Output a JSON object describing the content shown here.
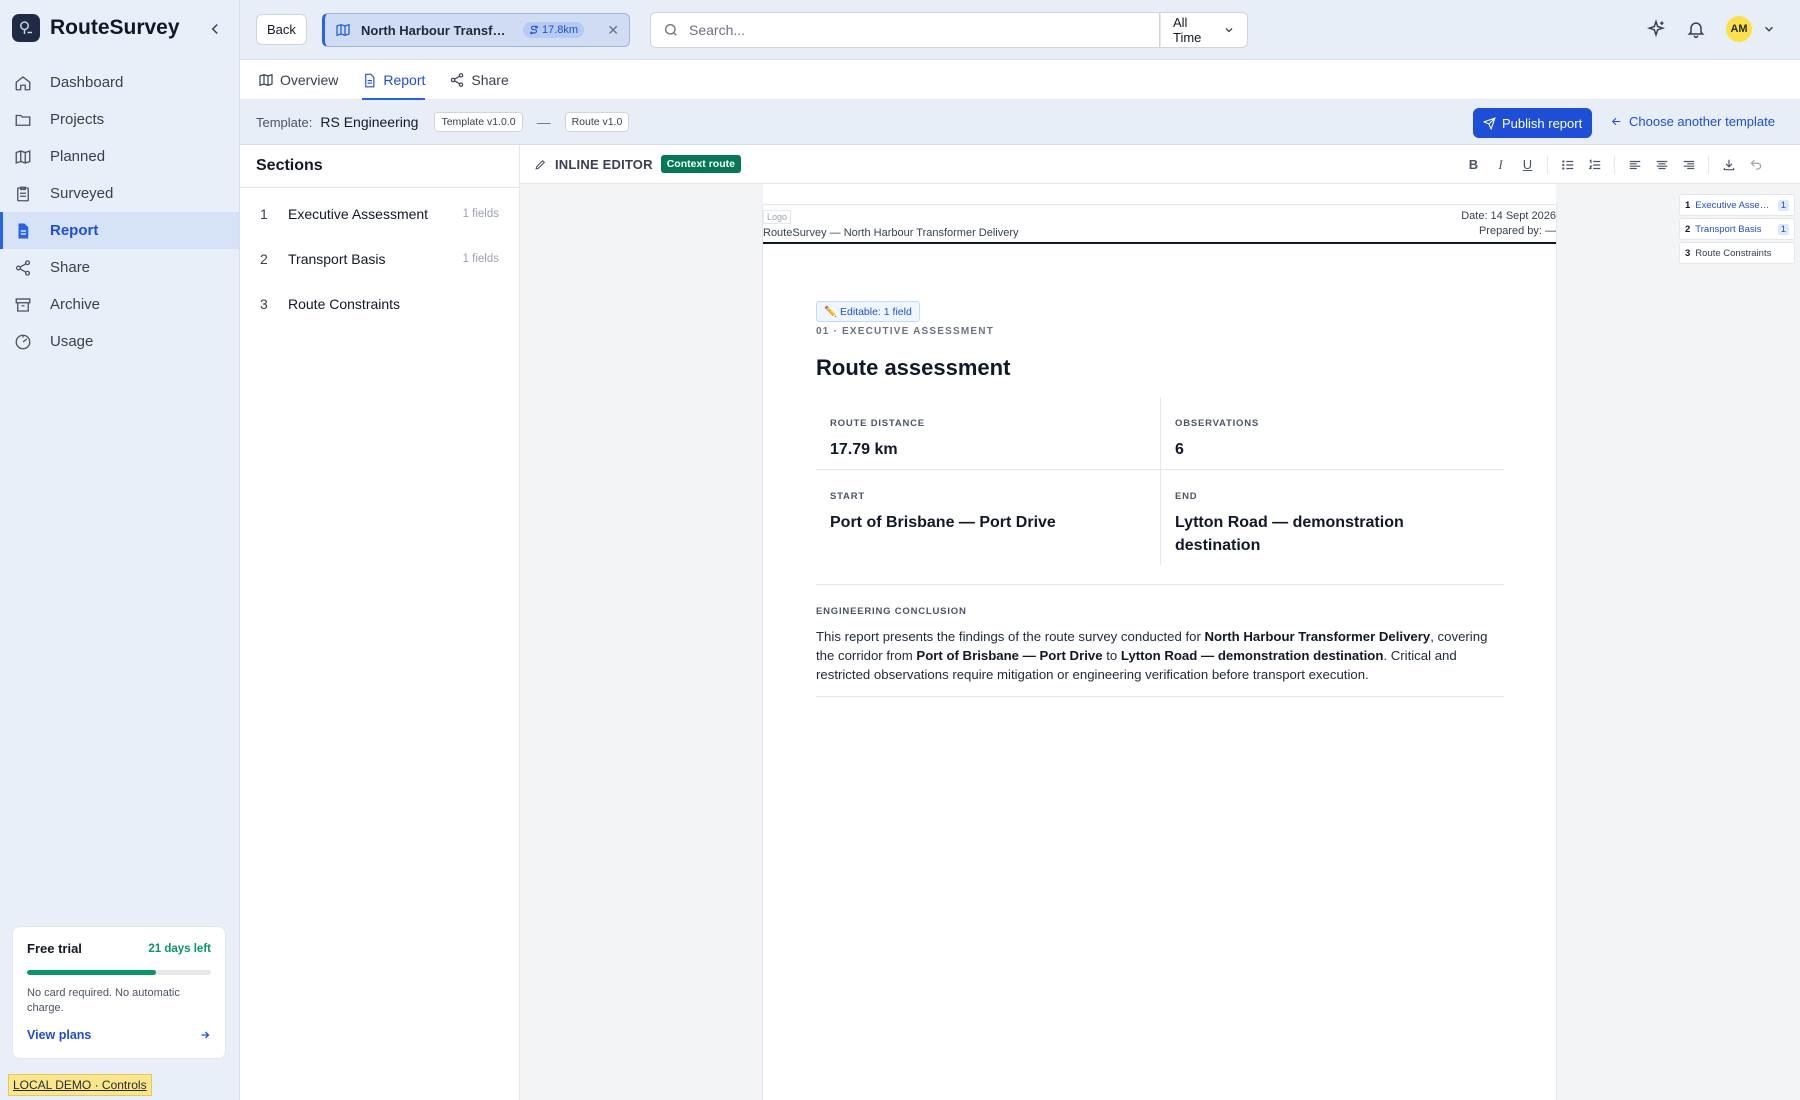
{
  "app": {
    "name": "RouteSurvey"
  },
  "nav": [
    {
      "label": "Dashboard",
      "icon": "home-icon"
    },
    {
      "label": "Projects",
      "icon": "folder-icon"
    },
    {
      "label": "Planned",
      "icon": "map-icon"
    },
    {
      "label": "Surveyed",
      "icon": "clipboard-icon"
    },
    {
      "label": "Report",
      "icon": "document-icon",
      "active": true
    },
    {
      "label": "Share",
      "icon": "share-icon"
    },
    {
      "label": "Archive",
      "icon": "archive-icon"
    },
    {
      "label": "Usage",
      "icon": "gauge-icon"
    }
  ],
  "trial": {
    "title": "Free trial",
    "days_left": "21 days left",
    "progress": 0.7,
    "note": "No card required. No automatic charge.",
    "link": "View plans"
  },
  "demo_badge": "LOCAL DEMO · Controls",
  "topbar": {
    "back": "Back",
    "route_title": "North Harbour Transformer Delivery",
    "route_km": "17.8km",
    "search_placeholder": "Search...",
    "range": "All Time",
    "avatar": "AM"
  },
  "tabs": [
    {
      "label": "Overview",
      "icon": "map-icon"
    },
    {
      "label": "Report",
      "icon": "document-icon",
      "active": true
    },
    {
      "label": "Share",
      "icon": "share-icon"
    }
  ],
  "template_bar": {
    "label": "Template:",
    "name": "RS Engineering",
    "template_version": "Template v1.0.0",
    "dash": "—",
    "route_version": "Route v1.0",
    "publish": "Publish report",
    "choose": "Choose another template"
  },
  "sections": {
    "title": "Sections",
    "items": [
      {
        "num": "1",
        "name": "Executive Assessment",
        "count": "1 fields"
      },
      {
        "num": "2",
        "name": "Transport Basis",
        "count": "1 fields"
      },
      {
        "num": "3",
        "name": "Route Constraints",
        "count": ""
      }
    ]
  },
  "editor": {
    "label": "INLINE EDITOR",
    "context": "Context route"
  },
  "report": {
    "logo": "Logo",
    "header_title": "RouteSurvey — North Harbour Transformer Delivery",
    "date": "Date: 14 Sept 2026",
    "prepared": "Prepared by: —",
    "editable": "✏️ Editable: 1 field",
    "kicker": "01 · EXECUTIVE ASSESSMENT",
    "title": "Route assessment",
    "facts": {
      "distance_label": "ROUTE DISTANCE",
      "distance": "17.79 km",
      "obs_label": "OBSERVATIONS",
      "obs": "6",
      "start_label": "START",
      "start": "Port of Brisbane — Port Drive",
      "end_label": "END",
      "end": "Lytton Road — demonstration destination"
    },
    "conclusion_label": "ENGINEERING CONCLUSION",
    "conclusion": {
      "p1": "This report presents the findings of the route survey conducted for ",
      "b1": "North Harbour Transformer Delivery",
      "p2": ", covering the corridor from ",
      "b2": "Port of Brisbane — Port Drive",
      "p3": " to ",
      "b3": "Lytton Road — demonstration destination",
      "p4": ". Critical and restricted observations require mitigation or engineering verification before transport execution."
    }
  },
  "minimap": [
    {
      "num": "1",
      "label": "Executive Assessment",
      "count": "1"
    },
    {
      "num": "2",
      "label": "Transport Basis",
      "count": "1"
    },
    {
      "num": "3",
      "label": "Route Constraints",
      "count": ""
    }
  ],
  "colors": {
    "accent": "#2563eb",
    "success": "#059669",
    "context_badge": "#047857"
  }
}
